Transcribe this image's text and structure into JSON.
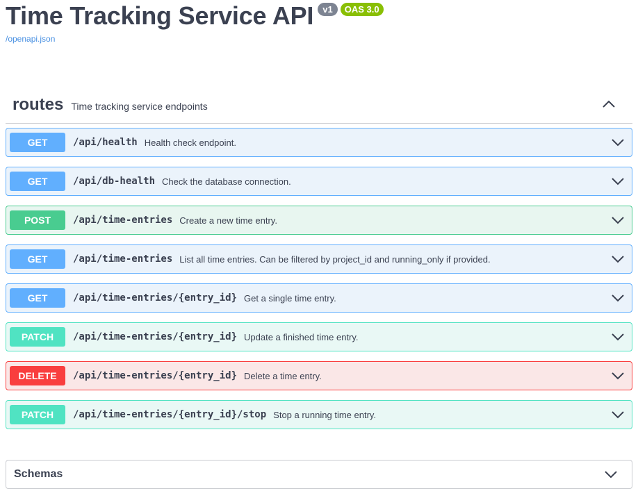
{
  "info": {
    "title": "Time Tracking Service API",
    "version": "v1",
    "oas": "OAS 3.0",
    "spec_link": "/openapi.json"
  },
  "tag": {
    "name": "routes",
    "description": "Time tracking service endpoints",
    "toggle_icon": "chevron-up-icon"
  },
  "operations": [
    {
      "method": "GET",
      "path": "/api/health",
      "summary": "Health check endpoint."
    },
    {
      "method": "GET",
      "path": "/api/db-health",
      "summary": "Check the database connection."
    },
    {
      "method": "POST",
      "path": "/api/time-entries",
      "summary": "Create a new time entry."
    },
    {
      "method": "GET",
      "path": "/api/time-entries",
      "summary": "List all time entries. Can be filtered by project_id and running_only if provided."
    },
    {
      "method": "GET",
      "path": "/api/time-entries/{entry_id}",
      "summary": "Get a single time entry."
    },
    {
      "method": "PATCH",
      "path": "/api/time-entries/{entry_id}",
      "summary": "Update a finished time entry."
    },
    {
      "method": "DELETE",
      "path": "/api/time-entries/{entry_id}",
      "summary": "Delete a time entry."
    },
    {
      "method": "PATCH",
      "path": "/api/time-entries/{entry_id}/stop",
      "summary": "Stop a running time entry."
    }
  ],
  "schemas": {
    "title": "Schemas",
    "toggle_icon": "chevron-down-icon"
  },
  "colors": {
    "GET": "#61affe",
    "POST": "#49cc90",
    "PATCH": "#50e3c2",
    "DELETE": "#f93e3e"
  }
}
